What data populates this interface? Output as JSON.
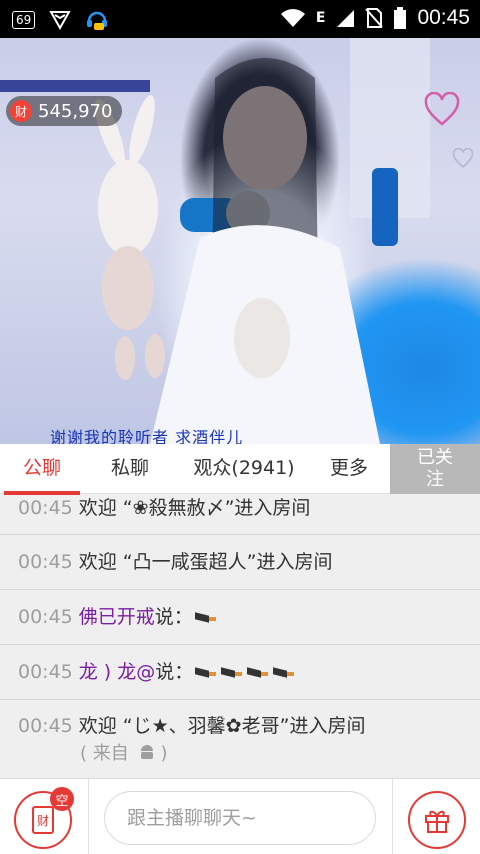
{
  "status_bar": {
    "notification_badge": "69",
    "network_type": "E",
    "time": "00:45"
  },
  "video": {
    "fortune_icon": "财",
    "fortune_count": "545,970",
    "caption": "谢谢我的聆听者   求酒伴儿"
  },
  "tabs": [
    {
      "label": "公聊",
      "active": true
    },
    {
      "label": "私聊",
      "active": false
    },
    {
      "label": "观众(2941)",
      "active": false
    },
    {
      "label": "更多",
      "active": false
    }
  ],
  "follow_button": {
    "line1": "已关",
    "line2": "注"
  },
  "chat": [
    {
      "time": "00:45",
      "text": "欢迎 “❀殺無赦〆”进入房间"
    },
    {
      "time": "00:45",
      "text": "欢迎 “凸一咸蛋超人”进入房间"
    },
    {
      "time": "00:45",
      "name": "佛已开戒",
      "says": "说：",
      "knives": 1
    },
    {
      "time": "00:45",
      "name": "龙 ) 龙@",
      "says": "说：",
      "knives": 4
    },
    {
      "time": "00:45",
      "text": "欢迎 “じ★、羽馨✿老哥”进入房间",
      "from": "( 来自",
      "from_end": ")"
    }
  ],
  "bottom_bar": {
    "rich_icon": "财",
    "rich_badge": "空",
    "input_placeholder": "跟主播聊聊天~"
  },
  "colors": {
    "accent": "#e53935",
    "username": "#7b1fa2",
    "caption": "#1a35b8",
    "follow_bg": "#b8b8b8"
  }
}
